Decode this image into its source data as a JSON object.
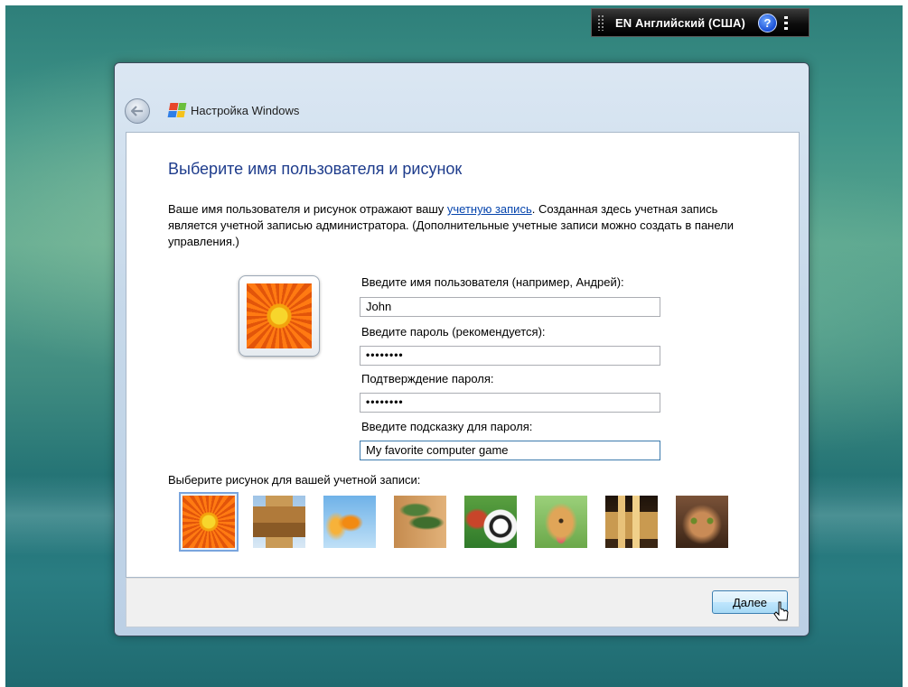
{
  "language_bar": {
    "label": "EN Английский (США)",
    "help_glyph": "?"
  },
  "window": {
    "title": "Настройка Windows"
  },
  "page": {
    "heading": "Выберите имя пользователя и рисунок",
    "description_before_link": "Ваше имя пользователя и рисунок отражают вашу ",
    "description_link": "учетную запись",
    "description_after_link": ". Созданная здесь учетная запись является учетной записью администратора. (Дополнительные учетные записи можно создать в панели управления.)"
  },
  "form": {
    "username_label": "Введите имя пользователя (например, Андрей):",
    "username_value": "John",
    "password_label": "Введите пароль (рекомендуется):",
    "password_value": "••••••••",
    "confirm_label": "Подтверждение пароля:",
    "confirm_value": "••••••••",
    "hint_label": "Введите подсказку для пароля:",
    "hint_value": "My favorite computer game"
  },
  "pictures": {
    "label": "Выберите рисунок для вашей учетной записи:",
    "items": [
      "flower",
      "robot",
      "goldfish",
      "bonsai",
      "soccer-ball",
      "puppy",
      "chess",
      "kitten"
    ],
    "selected_index": 0
  },
  "footer": {
    "next_label": "Далее"
  }
}
